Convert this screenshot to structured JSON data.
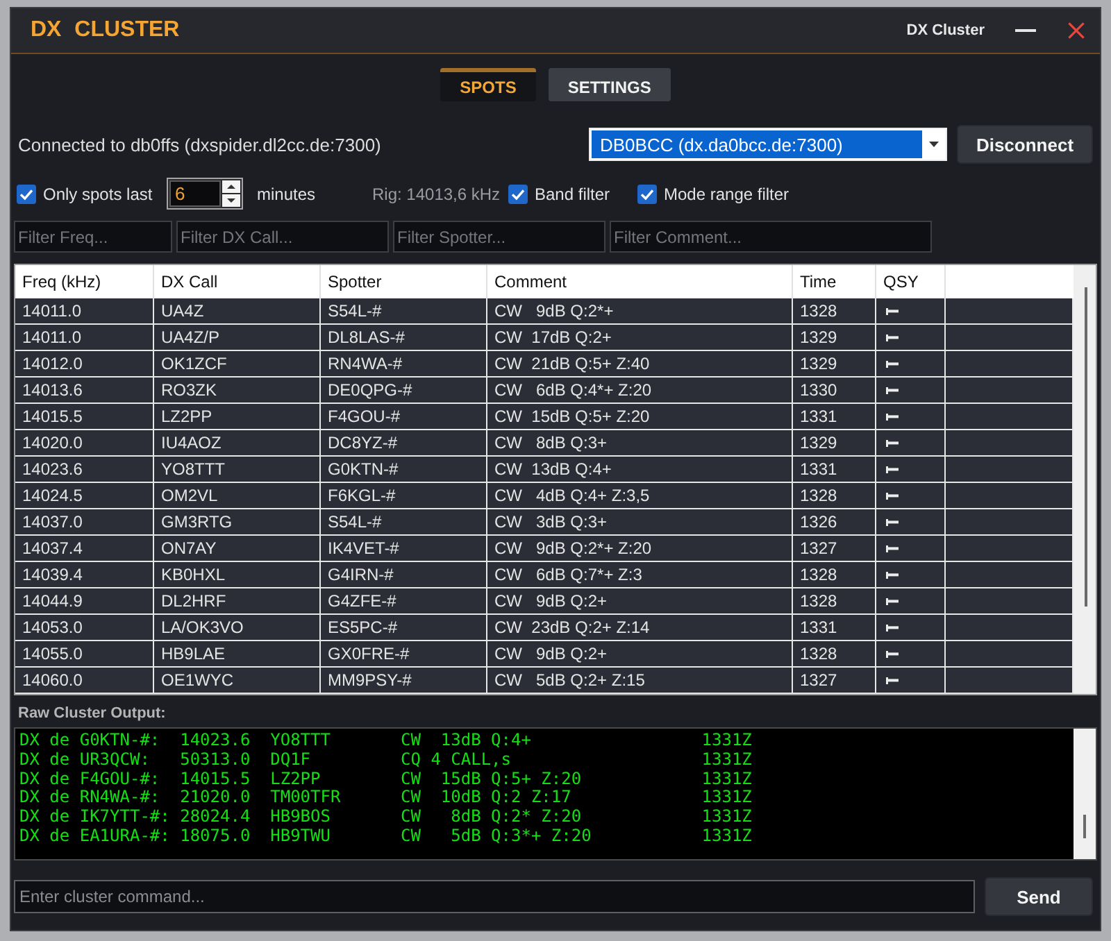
{
  "window": {
    "title": "DX CLUSTER",
    "caption": "DX Cluster"
  },
  "tabs": [
    {
      "label": "SPOTS",
      "selected": true
    },
    {
      "label": "SETTINGS",
      "selected": false
    }
  ],
  "connection": {
    "status": "Connected to db0ffs (dxspider.dl2cc.de:7300)",
    "server_select": {
      "value": "DB0BCC (dx.da0bcc.de:7300)",
      "focused": true
    },
    "button": "Disconnect"
  },
  "options": {
    "items": [
      {
        "kind": "checkbox",
        "label": "Only spots last",
        "checked": true
      },
      {
        "kind": "spinbox",
        "value": "6"
      },
      {
        "kind": "label",
        "text": "minutes"
      },
      {
        "kind": "info",
        "text": "Rig: 14013,6 kHz"
      },
      {
        "kind": "checkbox",
        "label": "Band filter",
        "checked": true
      },
      {
        "kind": "checkbox",
        "label": "Mode range filter",
        "checked": true
      }
    ]
  },
  "column_filters": [
    {
      "placeholder": "Filter Freq..."
    },
    {
      "placeholder": "Filter DX Call..."
    },
    {
      "placeholder": "Filter Spotter..."
    },
    {
      "placeholder": "Filter Comment..."
    }
  ],
  "table": {
    "columns": [
      {
        "label": "Freq (kHz)",
        "kind": "text"
      },
      {
        "label": "DX Call",
        "kind": "text"
      },
      {
        "label": "Spotter",
        "kind": "text"
      },
      {
        "label": "Comment",
        "kind": "text"
      },
      {
        "label": "Time",
        "kind": "text"
      },
      {
        "label": "QSY",
        "kind": "icon"
      }
    ],
    "rows": [
      {
        "cells": [
          "14011.0",
          "UA4Z",
          "S54L-#",
          "CW   9dB Q:2*+",
          "1328"
        ]
      },
      {
        "cells": [
          "14011.0",
          "UA4Z/P",
          "DL8LAS-#",
          "CW  17dB Q:2+",
          "1329"
        ]
      },
      {
        "cells": [
          "14012.0",
          "OK1ZCF",
          "RN4WA-#",
          "CW  21dB Q:5+ Z:40",
          "1329"
        ]
      },
      {
        "cells": [
          "14013.6",
          "RO3ZK",
          "DE0QPG-#",
          "CW   6dB Q:4*+ Z:20",
          "1330"
        ]
      },
      {
        "cells": [
          "14015.5",
          "LZ2PP",
          "F4GOU-#",
          "CW  15dB Q:5+ Z:20",
          "1331"
        ]
      },
      {
        "cells": [
          "14020.0",
          "IU4AOZ",
          "DC8YZ-#",
          "CW   8dB Q:3+",
          "1329"
        ]
      },
      {
        "cells": [
          "14023.6",
          "YO8TTT",
          "G0KTN-#",
          "CW  13dB Q:4+",
          "1331"
        ]
      },
      {
        "cells": [
          "14024.5",
          "OM2VL",
          "F6KGL-#",
          "CW   4dB Q:4+ Z:3,5",
          "1328"
        ]
      },
      {
        "cells": [
          "14037.0",
          "GM3RTG",
          "S54L-#",
          "CW   3dB Q:3+",
          "1326"
        ]
      },
      {
        "cells": [
          "14037.4",
          "ON7AY",
          "IK4VET-#",
          "CW   9dB Q:2*+ Z:20",
          "1327"
        ]
      },
      {
        "cells": [
          "14039.4",
          "KB0HXL",
          "G4IRN-#",
          "CW   6dB Q:7*+ Z:3",
          "1328"
        ]
      },
      {
        "cells": [
          "14044.9",
          "DL2HRF",
          "G4ZFE-#",
          "CW   9dB Q:2+",
          "1328"
        ]
      },
      {
        "cells": [
          "14053.0",
          "LA/OK3VO",
          "ES5PC-#",
          "CW  23dB Q:2+ Z:14",
          "1331"
        ]
      },
      {
        "cells": [
          "14055.0",
          "HB9LAE",
          "GX0FRE-#",
          "CW   9dB Q:2+",
          "1328"
        ]
      },
      {
        "cells": [
          "14060.0",
          "OE1WYC",
          "MM9PSY-#",
          "CW   5dB Q:2+ Z:15",
          "1327"
        ]
      }
    ]
  },
  "raw_output": {
    "label": "Raw Cluster Output:",
    "lines": [
      "DX de G0KTN-#:  14023.6  YO8TTT       CW  13dB Q:4+                 1331Z",
      "DX de UR3QCW:   50313.0  DQ1F         CQ 4 CALL,s                   1331Z",
      "DX de F4GOU-#:  14015.5  LZ2PP        CW  15dB Q:5+ Z:20            1331Z",
      "DX de RN4WA-#:  21020.0  TM00TFR      CW  10dB Q:2 Z:17             1331Z",
      "DX de IK7YTT-#: 28024.4  HB9BOS       CW   8dB Q:2* Z:20            1331Z",
      "DX de EA1URA-#: 18075.0  HB9TWU       CW   5dB Q:3*+ Z:20           1331Z"
    ]
  },
  "command": {
    "placeholder": "Enter cluster command...",
    "button": "Send"
  }
}
